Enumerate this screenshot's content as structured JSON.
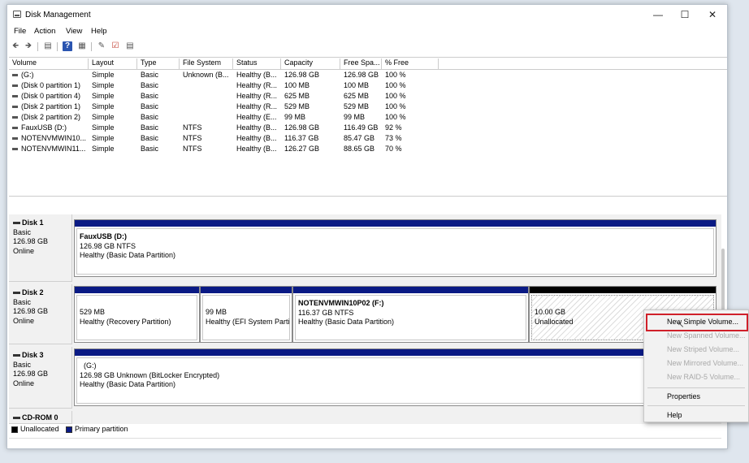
{
  "window": {
    "title": "Disk Management"
  },
  "menu": [
    "File",
    "Action",
    "View",
    "Help"
  ],
  "toolbar_icons": [
    "back-icon",
    "forward-icon",
    "console-tree-icon",
    "help-icon",
    "properties-icon",
    "connect-icon",
    "check-icon",
    "settings-icon"
  ],
  "volume_list": {
    "columns": [
      "Volume",
      "Layout",
      "Type",
      "File System",
      "Status",
      "Capacity",
      "Free Spa...",
      "% Free"
    ],
    "rows": [
      [
        "(G:)",
        "Simple",
        "Basic",
        "Unknown (B...",
        "Healthy (B...",
        "126.98 GB",
        "126.98 GB",
        "100 %"
      ],
      [
        "(Disk 0 partition 1)",
        "Simple",
        "Basic",
        "",
        "Healthy (R...",
        "100 MB",
        "100 MB",
        "100 %"
      ],
      [
        "(Disk 0 partition 4)",
        "Simple",
        "Basic",
        "",
        "Healthy (R...",
        "625 MB",
        "625 MB",
        "100 %"
      ],
      [
        "(Disk 2 partition 1)",
        "Simple",
        "Basic",
        "",
        "Healthy (R...",
        "529 MB",
        "529 MB",
        "100 %"
      ],
      [
        "(Disk 2 partition 2)",
        "Simple",
        "Basic",
        "",
        "Healthy (E...",
        "99 MB",
        "99 MB",
        "100 %"
      ],
      [
        "FauxUSB (D:)",
        "Simple",
        "Basic",
        "NTFS",
        "Healthy (B...",
        "126.98 GB",
        "116.49 GB",
        "92 %"
      ],
      [
        "NOTENVMWIN10...",
        "Simple",
        "Basic",
        "NTFS",
        "Healthy (B...",
        "116.37 GB",
        "85.47 GB",
        "73 %"
      ],
      [
        "NOTENVMWIN11...",
        "Simple",
        "Basic",
        "NTFS",
        "Healthy (B...",
        "126.27 GB",
        "88.65 GB",
        "70 %"
      ]
    ]
  },
  "disks": [
    {
      "name": "Disk 1",
      "type": "Basic",
      "size": "126.98 GB",
      "state": "Online",
      "partitions": [
        {
          "name": "FauxUSB  (D:)",
          "detail": "126.98 GB NTFS",
          "status": "Healthy (Basic Data Partition)"
        }
      ]
    },
    {
      "name": "Disk 2",
      "type": "Basic",
      "size": "126.98 GB",
      "state": "Online",
      "partitions": [
        {
          "name": "",
          "detail": "529 MB",
          "status": "Healthy (Recovery Partition)"
        },
        {
          "name": "",
          "detail": "99 MB",
          "status": "Healthy (EFI System Parti"
        },
        {
          "name": "NOTENVMWIN10P02  (F:)",
          "detail": "116.37 GB NTFS",
          "status": "Healthy (Basic Data Partition)"
        },
        {
          "name": "",
          "detail": "10.00 GB",
          "status": "Unallocated"
        }
      ]
    },
    {
      "name": "Disk 3",
      "type": "Basic",
      "size": "126.98 GB",
      "state": "Online",
      "partitions": [
        {
          "name": "(G:)",
          "detail": "126.98 GB Unknown (BitLocker Encrypted)",
          "status": "Healthy (Basic Data Partition)"
        }
      ]
    },
    {
      "name": "CD-ROM 0"
    }
  ],
  "legend": [
    {
      "label": "Unallocated",
      "color": "#000000"
    },
    {
      "label": "Primary partition",
      "color": "#0a1a84"
    }
  ],
  "context_menu": {
    "items": [
      {
        "label": "New Simple Volume...",
        "enabled": true
      },
      {
        "label": "New Spanned Volume...",
        "enabled": false
      },
      {
        "label": "New Striped Volume...",
        "enabled": false
      },
      {
        "label": "New Mirrored Volume...",
        "enabled": false
      },
      {
        "label": "New RAID-5 Volume...",
        "enabled": false
      },
      {
        "label": "Properties",
        "enabled": true
      },
      {
        "label": "Help",
        "enabled": true
      }
    ]
  }
}
